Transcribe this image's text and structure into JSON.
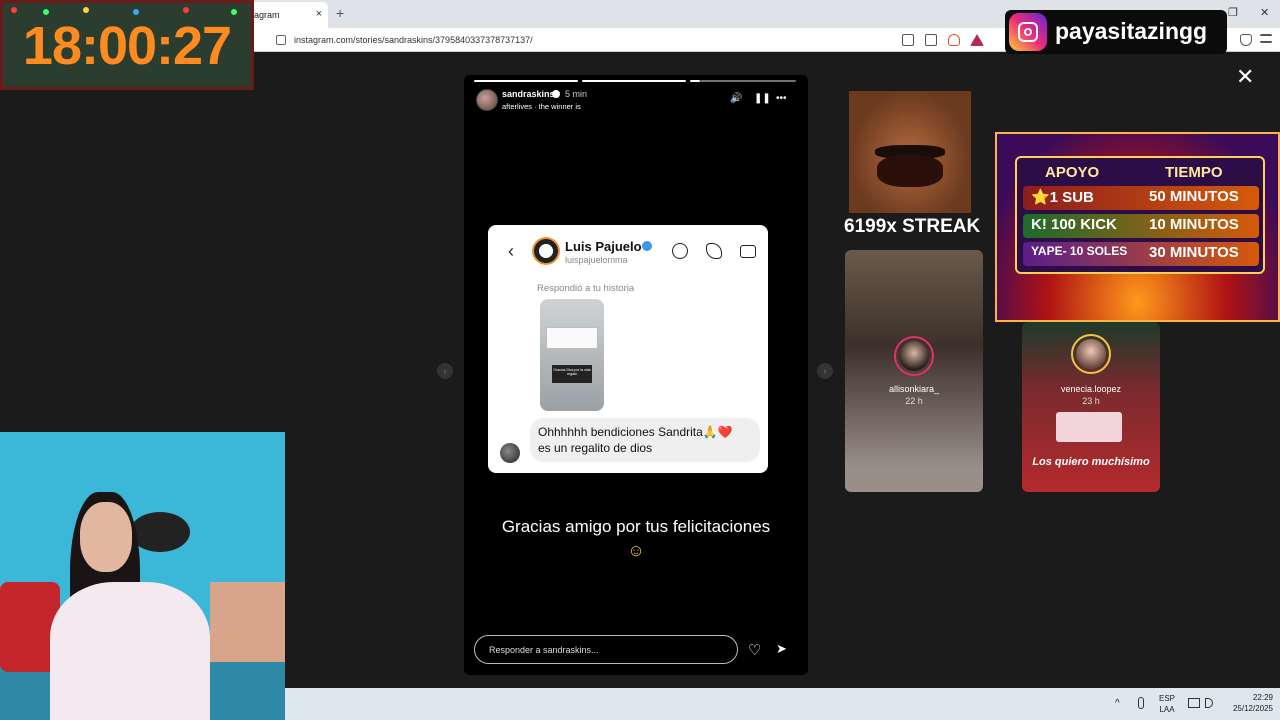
{
  "browser": {
    "tab_label": "agram",
    "tab_close": "×",
    "new_tab": "+",
    "url": "instagram.com/stories/sandraskins/3795840337378737137/",
    "minimize": "—",
    "maximize": "❐",
    "close": "✕"
  },
  "story": {
    "username": "sandraskins",
    "time": "5 min",
    "music": "afterlives · the winner is",
    "caption_line1": "Gracias amigo por tus felicitaciones",
    "caption_emoji": "☺",
    "reply_placeholder": "Responder a sandraskins...",
    "volume_icon": "🔊",
    "pause_icon": "❚❚",
    "more_icon": "•••",
    "like_icon": "♡",
    "send_icon": "➤",
    "prev_icon": "‹",
    "next_icon": "›"
  },
  "dm": {
    "back": "‹",
    "name": "Luis Pajuelo",
    "handle": "luispajuelomma",
    "replied": "Respondió a tu historia",
    "thumb_text": "Gracias Dios por la vida regalo",
    "message_line1": "Ohhhhhh bendiciones Sandrita🙏❤️",
    "message_line2": "es un regalito de dios"
  },
  "close_label": "✕",
  "side_stories": [
    {
      "name": "allisonkiara_",
      "time": "22 h"
    },
    {
      "name": "venecia.loopez",
      "time": "23 h",
      "text": "Los quiero muchísimo"
    }
  ],
  "overlays": {
    "clock": "18:00:27",
    "instagram_handle": "payasitazingg",
    "streak": "6199x STREAK",
    "panel_headers": [
      "APOYO",
      "TIEMPO"
    ],
    "panel_rows": [
      {
        "left": "⭐1 SUB",
        "right": "50 MINUTOS"
      },
      {
        "left": "K! 100 KICK",
        "right": "10 MINUTOS"
      },
      {
        "left": "YAPE- 10 SOLES",
        "right": "30 MINUTOS"
      }
    ]
  },
  "taskbar": {
    "lang1": "ESP",
    "lang2": "LAA",
    "time": "22:29",
    "date": "25/12/2025",
    "chevron": "^"
  },
  "colors": {
    "accent": "#3897f0",
    "clock_orange": "#ff8a1f",
    "ring": "#e1306c"
  }
}
